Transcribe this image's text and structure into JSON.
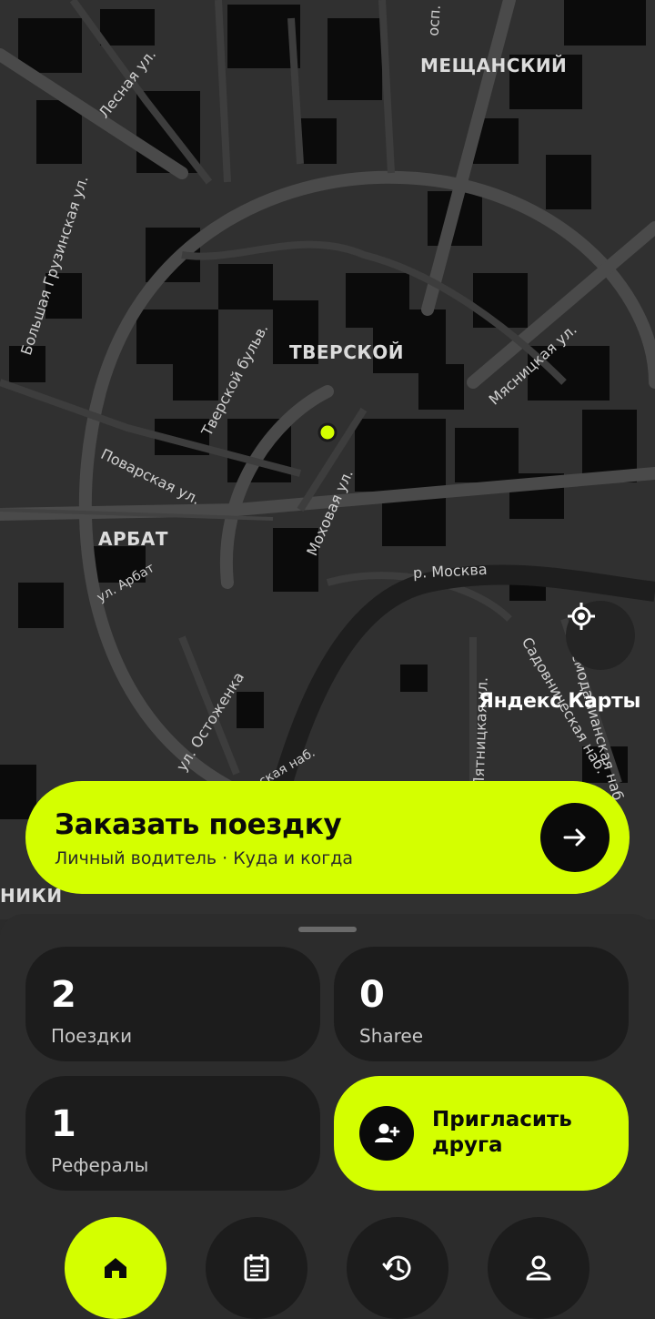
{
  "map": {
    "districts": [
      "МЕЩАНСКИЙ",
      "ТВЕРСКОЙ",
      "АРБАТ",
      "НИКИ"
    ],
    "streets": [
      "Лесная ул.",
      "Большая Грузинская ул.",
      "Тверской бульв.",
      "Мясницкая ул.",
      "Поварская ул.",
      "Моховая ул.",
      "ул. Арбат",
      "р. Москва",
      "Садовническая наб.",
      "ул. Остоженка",
      "Пятницкая ул.",
      "Космодамианская наб.",
      "ская наб.",
      "осп."
    ],
    "brand": "Яндекс Карты",
    "pin_color": "#d4ff00"
  },
  "order": {
    "title": "Заказать поездку",
    "subtitle": "Личный водитель · Куда и когда",
    "go_icon": "arrow-right-icon"
  },
  "stats": [
    {
      "value": "2",
      "label": "Поездки"
    },
    {
      "value": "0",
      "label": "Sharee"
    },
    {
      "value": "1",
      "label": "Рефералы"
    }
  ],
  "invite": {
    "label": "Пригласить друга",
    "icon": "person-add-icon"
  },
  "nav": [
    {
      "icon": "home-icon",
      "active": true
    },
    {
      "icon": "calendar-icon",
      "active": false
    },
    {
      "icon": "history-icon",
      "active": false
    },
    {
      "icon": "profile-icon",
      "active": false
    }
  ],
  "colors": {
    "accent": "#d4ff00",
    "surface": "#1c1c1c",
    "background": "#2c2c2c"
  }
}
